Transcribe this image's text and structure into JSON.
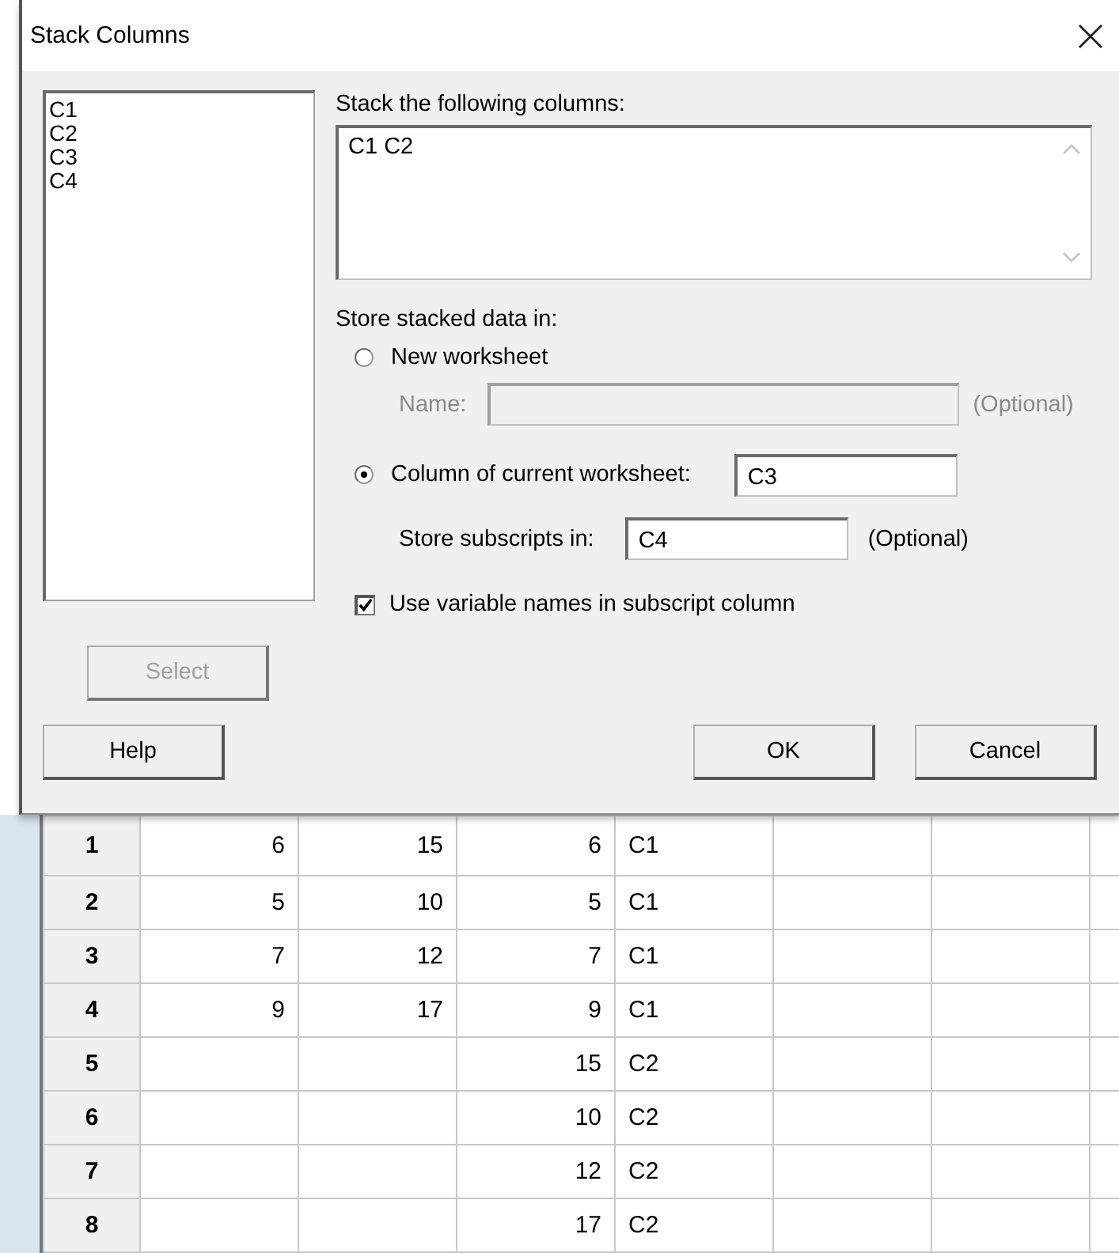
{
  "dialog": {
    "title": "Stack Columns",
    "variables": [
      "C1",
      "C2",
      "C3",
      "C4"
    ],
    "select_button": {
      "label": "Select",
      "disabled": true
    },
    "stack_label": "Stack the following columns:",
    "stack_value": "C1 C2",
    "store_label": "Store stacked data in:",
    "new_worksheet": {
      "label": "New worksheet",
      "selected": false,
      "name_label": "Name:",
      "disabled": true,
      "optional": "(Optional)"
    },
    "current_worksheet": {
      "label": "Column of current worksheet:",
      "selected": true,
      "value": "C3",
      "subscripts_label": "Store subscripts in:",
      "subscripts_value": "C4",
      "optional": "(Optional)"
    },
    "use_names": {
      "label": "Use variable names in subscript column",
      "checked": true
    },
    "buttons": [
      {
        "label": "Help",
        "kind": "help"
      },
      {
        "label": "OK",
        "kind": "ok"
      },
      {
        "label": "Cancel",
        "kind": "cancel"
      }
    ]
  },
  "worksheet": {
    "rows": [
      {
        "row": "1",
        "cells": [
          "6",
          "15",
          "6"
        ],
        "subscript": "C1"
      },
      {
        "row": "2",
        "cells": [
          "5",
          "10",
          "5"
        ],
        "subscript": "C1"
      },
      {
        "row": "3",
        "cells": [
          "7",
          "12",
          "7"
        ],
        "subscript": "C1"
      },
      {
        "row": "4",
        "cells": [
          "9",
          "17",
          "9"
        ],
        "subscript": "C1"
      },
      {
        "row": "5",
        "cells": [
          null,
          null,
          "15"
        ],
        "subscript": "C2"
      },
      {
        "row": "6",
        "cells": [
          null,
          null,
          "10"
        ],
        "subscript": "C2"
      },
      {
        "row": "7",
        "cells": [
          null,
          null,
          "12"
        ],
        "subscript": "C2"
      },
      {
        "row": "8",
        "cells": [
          null,
          null,
          "17"
        ],
        "subscript": "C2"
      }
    ]
  }
}
